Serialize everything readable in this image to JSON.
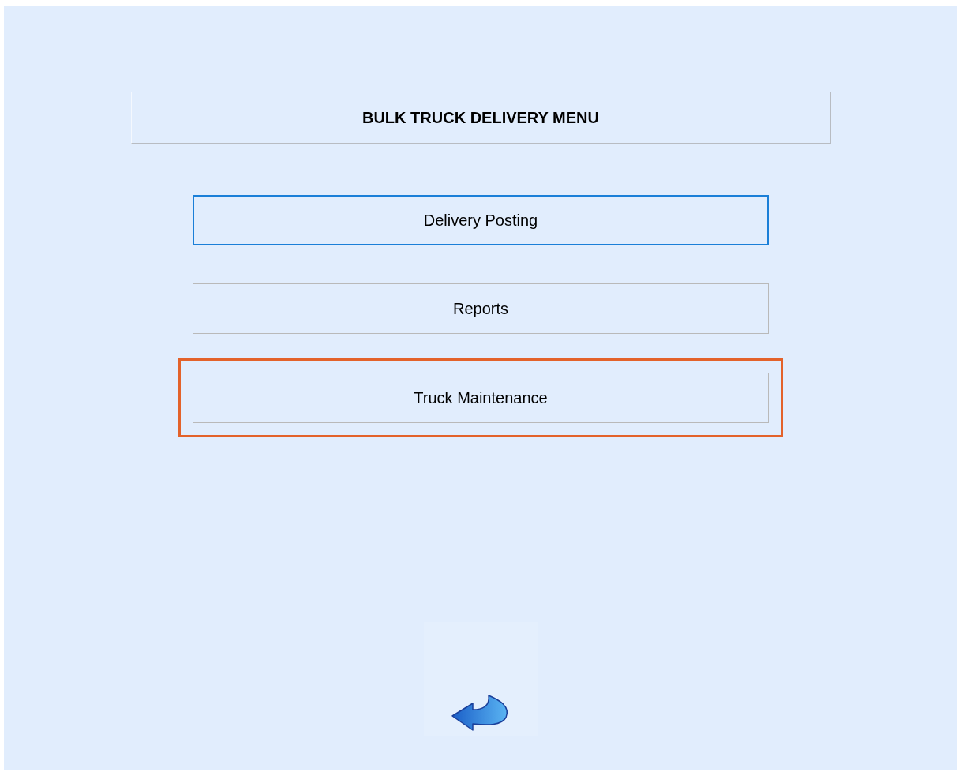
{
  "menu": {
    "title": "BULK TRUCK DELIVERY MENU",
    "items": [
      {
        "label": "Delivery Posting",
        "selected": true,
        "highlighted": false
      },
      {
        "label": "Reports",
        "selected": false,
        "highlighted": false
      },
      {
        "label": "Truck Maintenance",
        "selected": false,
        "highlighted": true
      }
    ]
  }
}
